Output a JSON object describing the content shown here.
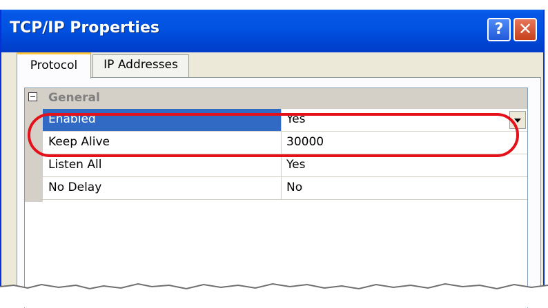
{
  "window": {
    "title": "TCP/IP Properties"
  },
  "title_buttons": {
    "help": "?",
    "close": "✕"
  },
  "tabs": [
    {
      "label": "Protocol",
      "active": true
    },
    {
      "label": "IP Addresses",
      "active": false
    }
  ],
  "property_grid": {
    "category": "General",
    "rows": [
      {
        "name": "Enabled",
        "value": "Yes",
        "selected": true
      },
      {
        "name": "Keep Alive",
        "value": "30000"
      },
      {
        "name": "Listen All",
        "value": "Yes"
      },
      {
        "name": "No Delay",
        "value": "No"
      }
    ]
  },
  "colors": {
    "titlebar": "#0052e0",
    "selection": "#316ac5",
    "highlight_ring": "#e4101a"
  }
}
